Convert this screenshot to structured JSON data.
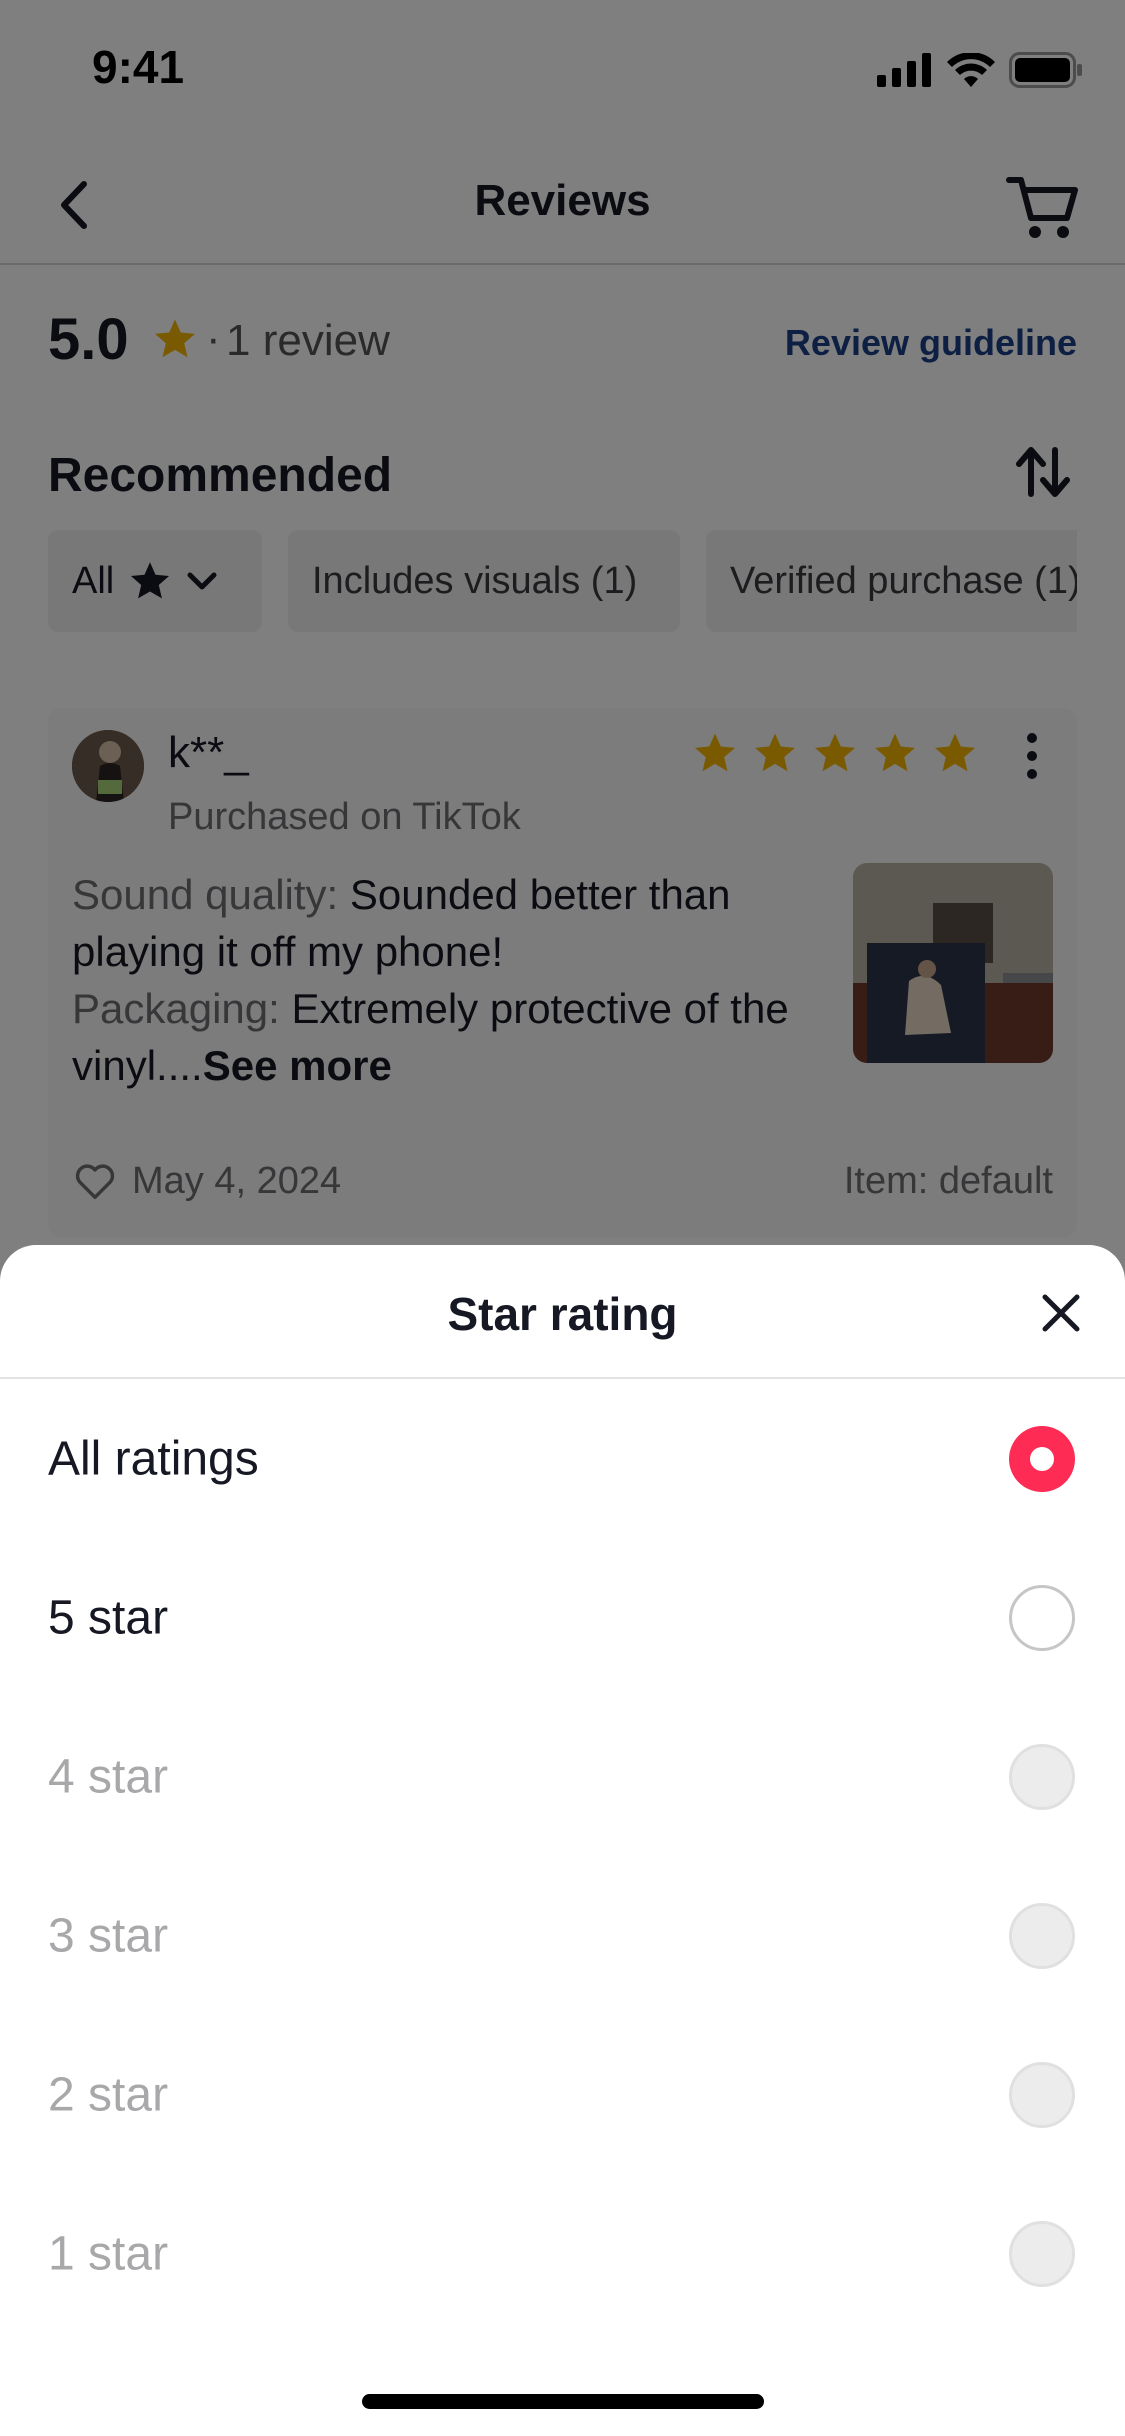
{
  "status_bar": {
    "time": "9:41"
  },
  "header": {
    "title": "Reviews"
  },
  "summary": {
    "rating": "5.0",
    "separator": "·",
    "review_count": "1 review",
    "guideline_link": "Review guideline"
  },
  "section": {
    "title": "Recommended"
  },
  "filters": [
    {
      "label": "All"
    },
    {
      "label": "Includes visuals (1)"
    },
    {
      "label": "Verified purchase (1)"
    }
  ],
  "review": {
    "name": "k**_",
    "stars": 5,
    "source": "Purchased on TikTok",
    "sound_label": "Sound quality:",
    "sound_text": " Sounded better than playing it off my phone!",
    "packaging_label": "Packaging:",
    "packaging_text": " Extremely protective of the vinyl....",
    "see_more": "See more",
    "date": "May 4, 2024",
    "item": "Item: default"
  },
  "sheet": {
    "title": "Star rating",
    "options": [
      {
        "label": "All ratings",
        "selected": true,
        "disabled": false
      },
      {
        "label": "5 star",
        "selected": false,
        "disabled": false
      },
      {
        "label": "4 star",
        "selected": false,
        "disabled": true
      },
      {
        "label": "3 star",
        "selected": false,
        "disabled": true
      },
      {
        "label": "2 star",
        "selected": false,
        "disabled": true
      },
      {
        "label": "1 star",
        "selected": false,
        "disabled": true
      }
    ]
  },
  "colors": {
    "accent": "#fe2c55",
    "star": "#f5b400",
    "link": "#1b3e86"
  }
}
